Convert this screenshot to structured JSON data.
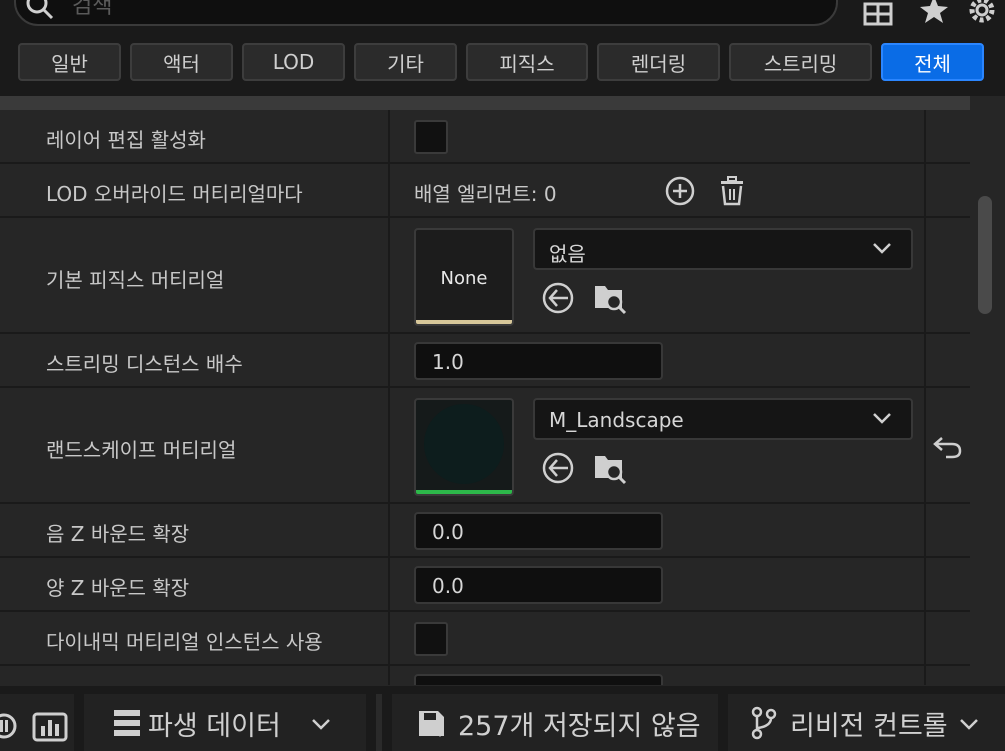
{
  "search": {
    "placeholder": "검색"
  },
  "toolbar_icons": [
    "grid-icon",
    "star-icon",
    "gear-icon"
  ],
  "tabs": [
    {
      "label": "일반",
      "active": false
    },
    {
      "label": "액터",
      "active": false
    },
    {
      "label": "LOD",
      "active": false
    },
    {
      "label": "기타",
      "active": false
    },
    {
      "label": "피직스",
      "active": false
    },
    {
      "label": "렌더링",
      "active": false
    },
    {
      "label": "스트리밍",
      "active": false
    },
    {
      "label": "전체",
      "active": true
    }
  ],
  "properties": {
    "layer_edit": {
      "label": "레이어 편집 활성화",
      "checked": false
    },
    "lod_override": {
      "label": "LOD 오버라이드 머티리얼마다",
      "value": "배열 엘리먼트: 0"
    },
    "physics_material": {
      "label": "기본 피직스 머티리얼",
      "thumb_text": "None",
      "selected": "없음"
    },
    "streaming_distance": {
      "label": "스트리밍 디스턴스 배수",
      "value": "1.0"
    },
    "landscape_material": {
      "label": "랜드스케이프 머티리얼",
      "selected": "M_Landscape"
    },
    "neg_z": {
      "label": "음 Z 바운드 확장",
      "value": "0.0"
    },
    "pos_z": {
      "label": "양 Z 바운드 확장",
      "value": "0.0"
    },
    "dynamic_material": {
      "label": "다이내믹 머티리얼 인스턴스 사용",
      "checked": false
    }
  },
  "statusbar": {
    "derived_data": "파생 데이터",
    "unsaved": "257개 저장되지 않음",
    "revision_control": "리비전 컨트롤"
  },
  "colors": {
    "accent": "#0a6ce6",
    "panel": "#262626",
    "landscape_underline": "#2db84a",
    "none_underline": "#d8c89a"
  }
}
